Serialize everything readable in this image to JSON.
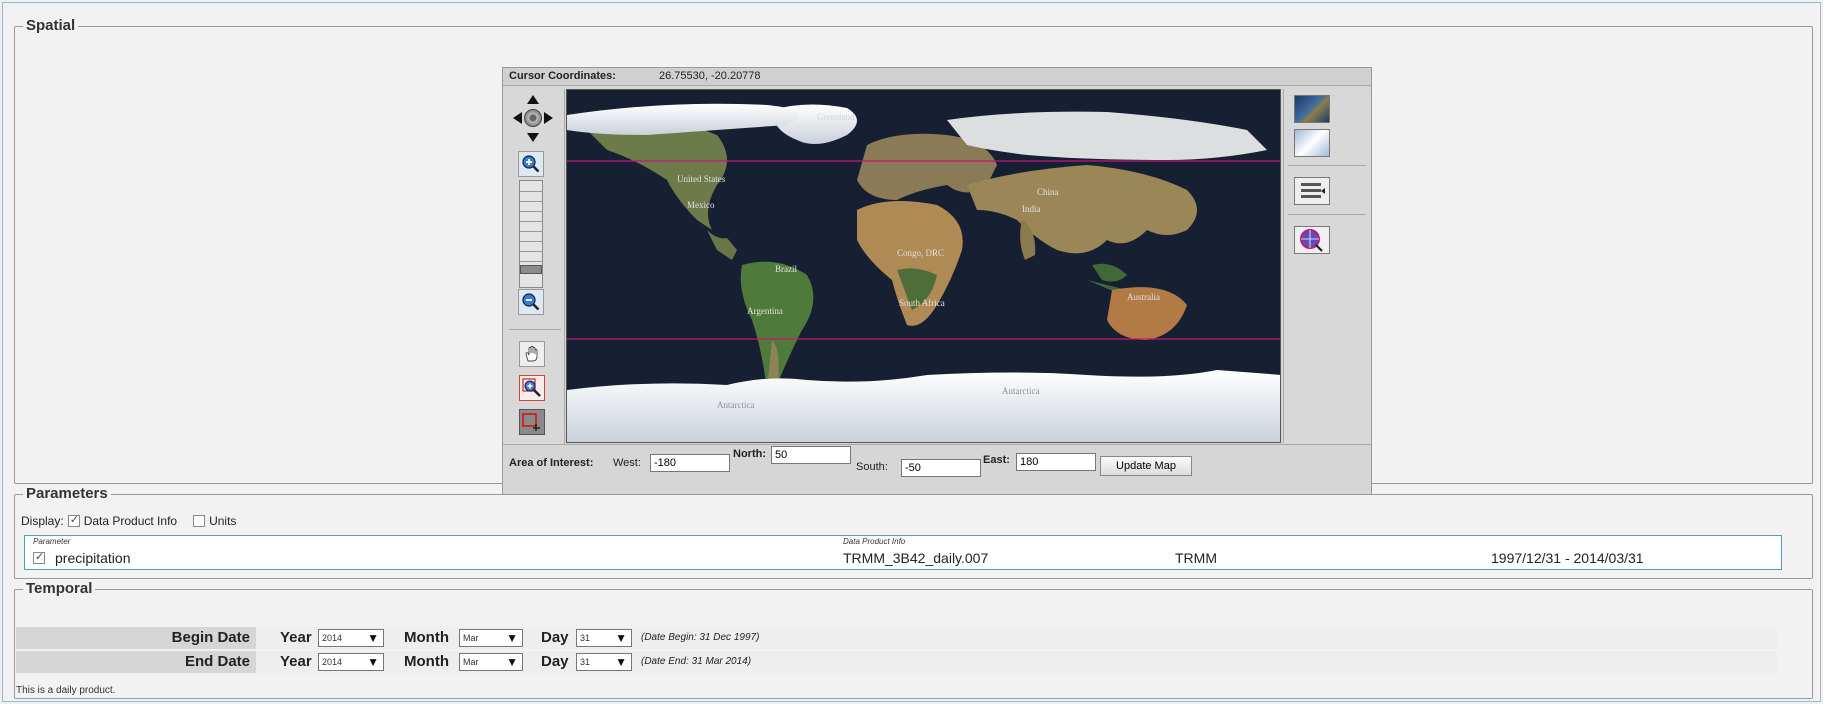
{
  "spatial": {
    "legend": "Spatial",
    "map": {
      "coords_label": "Cursor Coordinates:",
      "coords_value": "26.75530, -20.20778",
      "labels": {
        "greenland": "Greenland",
        "united_states": "United States",
        "mexico": "Mexico",
        "brazil": "Brazil",
        "argentina": "Argentina",
        "congo": "Congo, DRC",
        "south_africa": "South Africa",
        "china": "China",
        "india": "India",
        "australia": "Australia",
        "antarctica_left": "Antarctica",
        "antarctica_right": "Antarctica"
      },
      "icons": {
        "nav": "pan-arrows-icon",
        "zoom_in": "zoom-in-icon",
        "zoom_out": "zoom-out-icon",
        "pan": "hand-icon",
        "zoom_box": "zoom-box-icon",
        "draw_rect": "draw-rectangle-icon",
        "satellite": "satellite-map-icon",
        "plain": "plain-map-icon",
        "layers": "layers-icon",
        "globe": "globe-search-icon"
      },
      "zoom_level_fraction": 0.2,
      "bbox_color": "#c2187a"
    },
    "aoi": {
      "label": "Area of Interest:",
      "west_label": "West:",
      "west_value": "-180",
      "north_label": "North:",
      "north_value": "50",
      "south_label": "South:",
      "south_value": "-50",
      "east_label": "East:",
      "east_value": "180",
      "update_button": "Update Map"
    }
  },
  "parameters": {
    "legend": "Parameters",
    "display_label": "Display:",
    "display_options": [
      {
        "label": "Data Product Info",
        "checked": true
      },
      {
        "label": "Units",
        "checked": false
      }
    ],
    "headers": {
      "parameter": "Parameter",
      "data_product_info": "Data Product Info"
    },
    "rows": [
      {
        "checked": true,
        "name": "precipitation",
        "product": "TRMM_3B42_daily.007",
        "mission": "TRMM",
        "range": "1997/12/31 - 2014/03/31"
      }
    ]
  },
  "temporal": {
    "legend": "Temporal",
    "begin": {
      "label": "Begin Date",
      "year_label": "Year",
      "year": "2014",
      "month_label": "Month",
      "month": "Mar",
      "day_label": "Day",
      "day": "31",
      "note": "(Date Begin: 31 Dec 1997)"
    },
    "end": {
      "label": "End Date",
      "year_label": "Year",
      "year": "2014",
      "month_label": "Month",
      "month": "Mar",
      "day_label": "Day",
      "day": "31",
      "note": "(Date End: 31 Mar 2014)"
    },
    "daily_note": "This is a daily product."
  }
}
